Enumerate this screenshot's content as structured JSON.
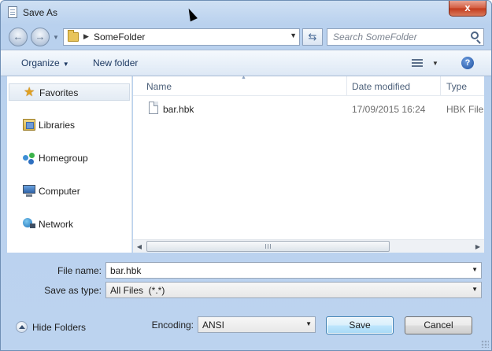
{
  "window": {
    "title": "Save As",
    "close_label": "x"
  },
  "nav": {
    "back_label": "←",
    "forward_label": "→"
  },
  "address": {
    "path": "SomeFolder"
  },
  "search": {
    "placeholder": "Search SomeFolder",
    "value": ""
  },
  "toolbar": {
    "organize_label": "Organize",
    "new_folder_label": "New folder",
    "help_label": "?"
  },
  "sidebar": {
    "items": [
      {
        "label": "Favorites",
        "icon": "star-icon",
        "selected": true
      },
      {
        "label": "Libraries",
        "icon": "libraries-icon"
      },
      {
        "label": "Homegroup",
        "icon": "homegroup-icon"
      },
      {
        "label": "Computer",
        "icon": "computer-icon"
      },
      {
        "label": "Network",
        "icon": "network-icon"
      }
    ]
  },
  "table": {
    "columns": [
      "Name",
      "Date modified",
      "Type"
    ],
    "rows": [
      {
        "name": "bar.hbk",
        "date": "17/09/2015 16:24",
        "type": "HBK File"
      }
    ]
  },
  "form": {
    "file_name_label": "File name:",
    "file_name_value": "bar.hbk",
    "save_type_label": "Save as type:",
    "save_type_value": "All Files  (*.*)",
    "encoding_label": "Encoding:",
    "encoding_value": "ANSI"
  },
  "footer": {
    "hide_folders_label": "Hide Folders",
    "save_label": "Save",
    "cancel_label": "Cancel"
  },
  "colors": {
    "title_bar": "#b9d1ee",
    "close_button": "#c23a1c",
    "default_button_border": "#3c7fb1"
  }
}
